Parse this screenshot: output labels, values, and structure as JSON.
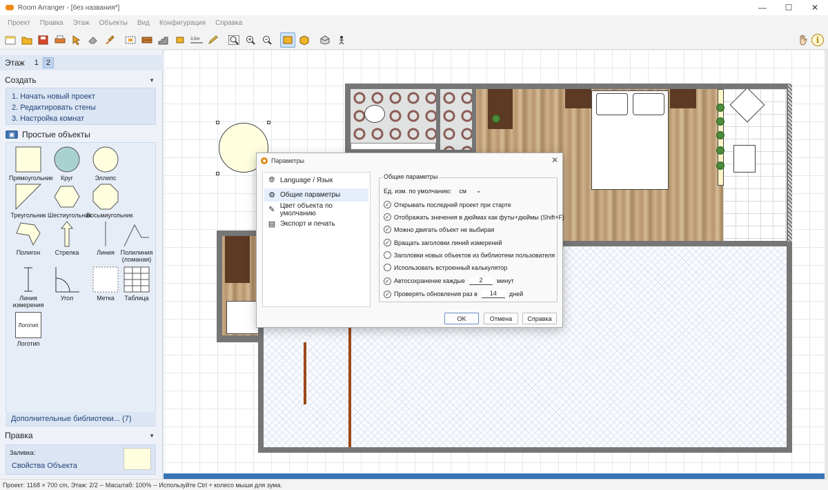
{
  "window": {
    "title": "Room Arranger - [без названия*]",
    "minimize": "—",
    "maximize": "☐",
    "close": "✕"
  },
  "menu": [
    "Проект",
    "Правка",
    "Этаж",
    "Объекты",
    "Вид",
    "Конфигурация",
    "Справка"
  ],
  "toolbar": {
    "icons": [
      "new-file-icon",
      "open-folder-icon",
      "save-icon",
      "print-icon",
      "pointer-tool-icon",
      "eraser-icon",
      "paint-brush-icon",
      "select-area-icon",
      "wall-icon",
      "stairs-icon",
      "resize-icon",
      "measure-tool-icon",
      "pencil-icon",
      "zoom-fit-icon",
      "zoom-in-icon",
      "zoom-out-icon",
      "2d-view-icon",
      "3d-view-icon",
      "3d-box-icon",
      "walk-icon"
    ],
    "measure_label": "3,5m",
    "info_label": "i"
  },
  "left_panel": {
    "floor": {
      "label": "Этаж",
      "floors": [
        "1",
        "2"
      ],
      "selected": "2"
    },
    "create": {
      "title": "Создать",
      "links": [
        "1. Начать новый проект",
        "2. Редактировать стены",
        "3. Настройка комнат"
      ]
    },
    "simple_objects": {
      "title": "Простые объекты",
      "items": [
        "Прямоугольник",
        "Круг",
        "Эллипс",
        "Треугольник",
        "Шестиугольник",
        "Восьмиугольник",
        "Полигон",
        "Стрелка",
        "Линия",
        "Полилиния (ломаная)",
        "Линия измерения",
        "Угол",
        "Метка",
        "Таблица",
        "Логотип"
      ],
      "logo_text": "Логотип"
    },
    "more_libraries": "Дополнительные библиотеки... (7)",
    "edit": {
      "title": "Правка",
      "fill_label": "Заливка:",
      "fill_color": "#ffffe0",
      "props_link": "Свойства Объекта"
    }
  },
  "dialog": {
    "title": "Параметры",
    "nav": [
      "Language / Язык",
      "Общие параметры",
      "Цвет объекта по умолчанию",
      "Экспорт и печать"
    ],
    "nav_selected": "Общие параметры",
    "group_title": "Общие параметры",
    "unit_label": "Ед. изм. по умолчанию:",
    "unit_value": "см",
    "options": [
      {
        "label": "Открывать последний проект при старте",
        "checked": true
      },
      {
        "label": "Отображать значения в дюймах как футы+дюймы (Shift+F)",
        "checked": true
      },
      {
        "label": "Можно двигать объект не выбирая",
        "checked": true
      },
      {
        "label": "Вращать заголовки линий измерений",
        "checked": true
      },
      {
        "label": "Заголовки новых объектов из библиотеки пользователя",
        "checked": false
      },
      {
        "label": "Использовать встроенный калькулятор",
        "checked": false
      }
    ],
    "autosave": {
      "label": "Автосохранение каждые",
      "value": "2",
      "unit": "минут",
      "checked": true
    },
    "updates": {
      "label": "Проверять обновления раз в",
      "value": "14",
      "unit": "дней",
      "checked": true
    },
    "buttons": {
      "ok": "OK",
      "cancel": "Отмена",
      "help": "Справка"
    }
  },
  "status": "Проект: 1168 × 700 cm, Этаж: 2/2 -- Масштаб: 100% -- Используйте Ctrl + колесо мыши для зума."
}
